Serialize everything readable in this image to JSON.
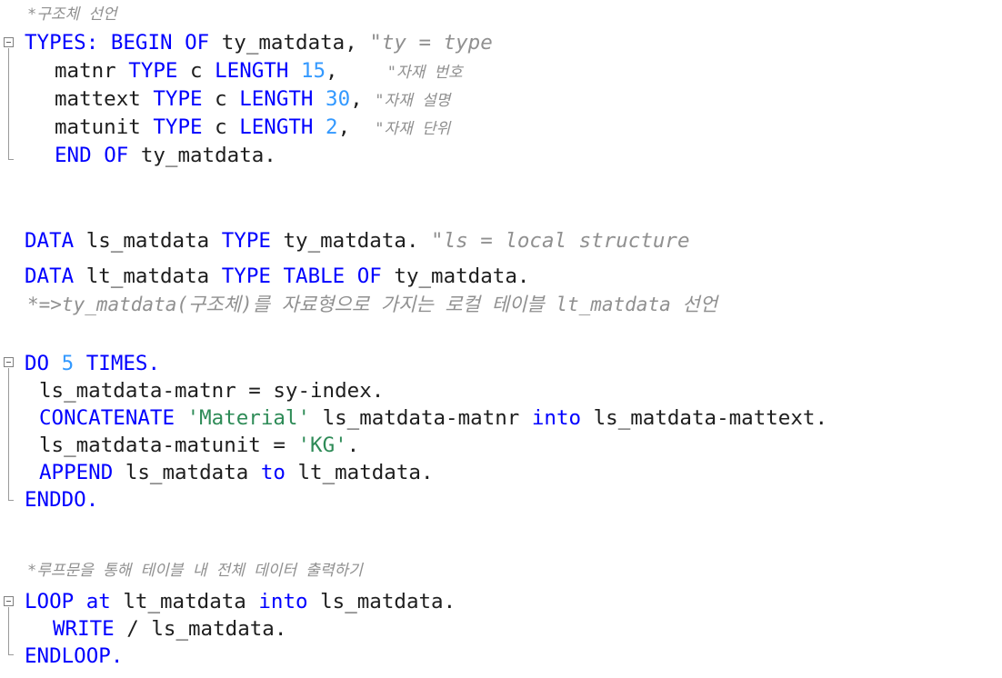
{
  "code": {
    "c1": "*구조체 선언",
    "t1_types": "TYPES:",
    "t1_begin": "BEGIN",
    "t1_of": "OF",
    "t1_name": "ty_matdata,",
    "t1_cmt": "\"ty = type",
    "t2_field": "matnr",
    "t2_type": "TYPE",
    "t2_c": "c",
    "t2_length": "LENGTH",
    "t2_num": "15",
    "t2_comma": ",",
    "t2_cmt": "\"자재 번호",
    "t3_field": "mattext",
    "t3_type": "TYPE",
    "t3_c": "c",
    "t3_length": "LENGTH",
    "t3_num": "30",
    "t3_comma": ",",
    "t3_cmt": "\"자재 설명",
    "t4_field": "matunit",
    "t4_type": "TYPE",
    "t4_c": "c",
    "t4_length": "LENGTH",
    "t4_num": "2",
    "t4_comma": ",",
    "t4_cmt": "\"자재 단위",
    "t5_end": "END",
    "t5_of": "OF",
    "t5_name": "ty_matdata.",
    "d1_data": "DATA",
    "d1_var": "ls_matdata",
    "d1_type": "TYPE",
    "d1_name": "ty_matdata.",
    "d1_cmt": "\"ls = local structure",
    "d2_data": "DATA",
    "d2_var": "lt_matdata",
    "d2_type": "TYPE",
    "d2_table": "TABLE",
    "d2_of": "OF",
    "d2_name": "ty_matdata.",
    "c2": "*=>ty_matdata(구조체)를 자료형으로 가지는 로컬 테이블 lt_matdata 선언",
    "l1_do": "DO",
    "l1_num": "5",
    "l1_times": "TIMES.",
    "l2_text": "ls_matdata-matnr = sy-index.",
    "l3_concat": "CONCATENATE",
    "l3_str": "'Material'",
    "l3_mid": "ls_matdata-matnr",
    "l3_into": "into",
    "l3_end": "ls_matdata-mattext.",
    "l4_text": "ls_matdata-matunit = ",
    "l4_str": "'KG'",
    "l4_dot": ".",
    "l5_append": "APPEND",
    "l5_mid": "ls_matdata",
    "l5_to": "to",
    "l5_end": "lt_matdata.",
    "l6_enddo": "ENDDO.",
    "c3": "*루프문을 통해 테이블 내 전체 데이터 출력하기",
    "p1_loop": "LOOP",
    "p1_at": "at",
    "p1_mid": "lt_matdata",
    "p1_into": "into",
    "p1_end": "ls_matdata.",
    "p2_write": "WRITE",
    "p2_rest": "/ ls_matdata.",
    "p3_endloop": "ENDLOOP."
  }
}
